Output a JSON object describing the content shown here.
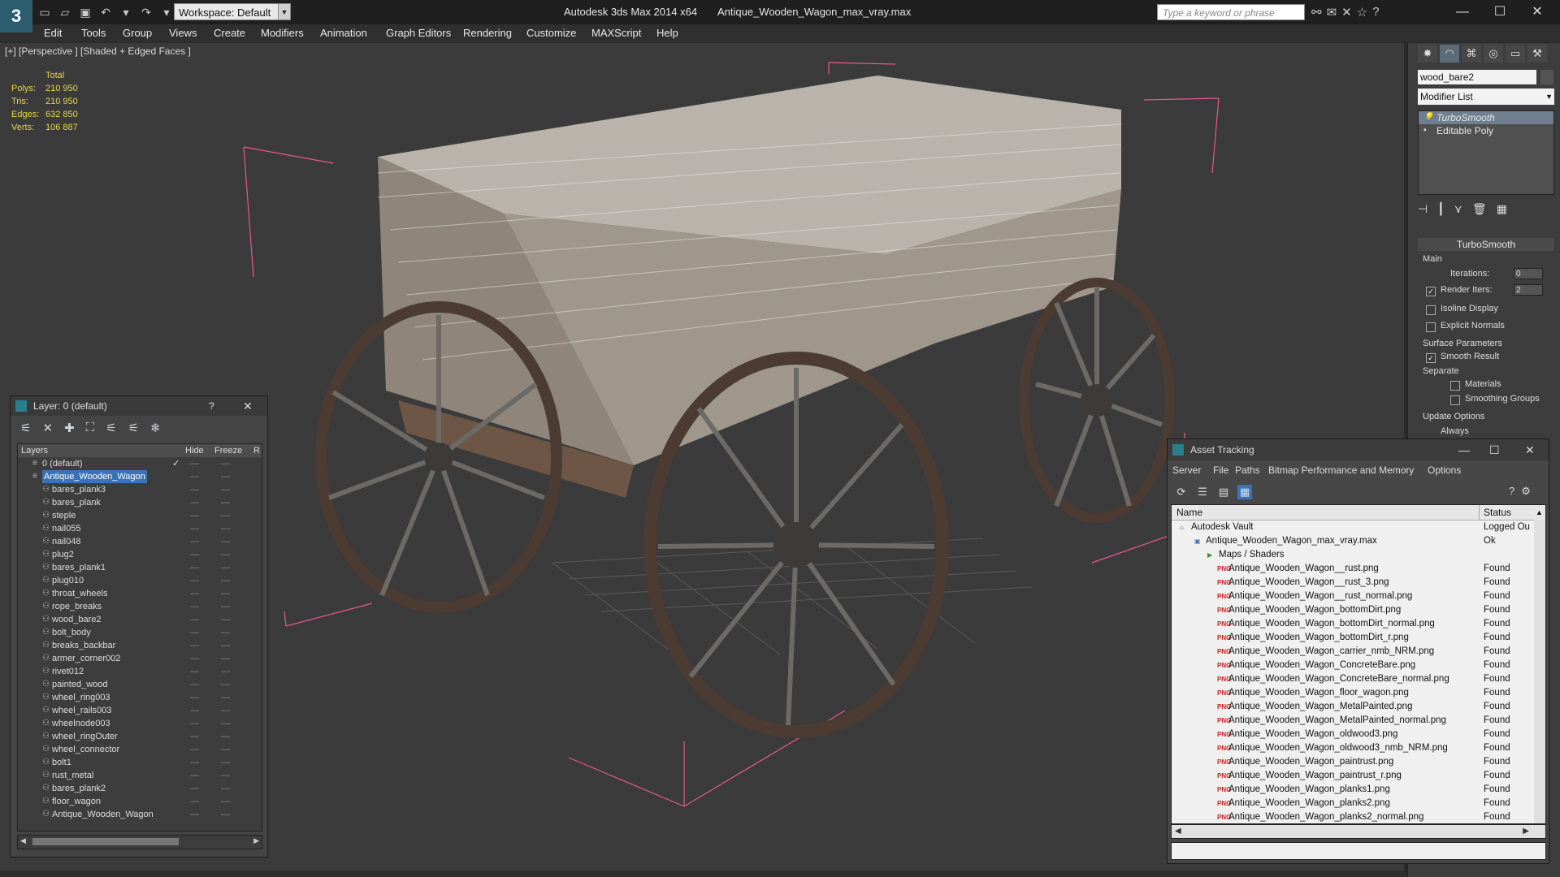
{
  "titlebar": {
    "app_title": "Autodesk 3ds Max  2014 x64",
    "file_title": "Antique_Wooden_Wagon_max_vray.max",
    "workspace": "Workspace: Default",
    "search_placeholder": "Type a keyword or phrase"
  },
  "menu": [
    "Edit",
    "Tools",
    "Group",
    "Views",
    "Create",
    "Modifiers",
    "Animation",
    "Graph Editors",
    "Rendering",
    "Customize",
    "MAXScript",
    "Help"
  ],
  "viewport": {
    "label": "[+] [Perspective ] [Shaded + Edged Faces ]",
    "stats": {
      "header": "Total",
      "rows": [
        {
          "k": "Polys:",
          "v": "210 950"
        },
        {
          "k": "Tris:",
          "v": "210 950"
        },
        {
          "k": "Edges:",
          "v": "632 850"
        },
        {
          "k": "Verts:",
          "v": "106 887"
        }
      ]
    }
  },
  "command_panel": {
    "object_name": "wood_bare2",
    "modifier_list": "Modifier List",
    "stack": [
      "TurboSmooth",
      "Editable Poly"
    ],
    "rollout": "TurboSmooth",
    "main_label": "Main",
    "iterations_label": "Iterations:",
    "iterations_value": "0",
    "render_iters_label": "Render Iters:",
    "render_iters_value": "2",
    "isoline": "Isoline Display",
    "explicit_normals": "Explicit Normals",
    "surface_params": "Surface Parameters",
    "smooth_result": "Smooth Result",
    "separate": "Separate",
    "materials": "Materials",
    "smoothing_groups": "Smoothing Groups",
    "update_options": "Update Options",
    "always": "Always"
  },
  "layer_window": {
    "title": "Layer: 0 (default)",
    "help": "?",
    "columns": {
      "layers": "Layers",
      "hide": "Hide",
      "freeze": "Freeze",
      "r": "R"
    },
    "rows": [
      {
        "name": "0 (default)",
        "level": 0,
        "check": "✓"
      },
      {
        "name": "Antique_Wooden_Wagon",
        "level": 0,
        "selected": true
      },
      {
        "name": "bares_plank3",
        "level": 1
      },
      {
        "name": "bares_plank",
        "level": 1
      },
      {
        "name": "steple",
        "level": 1
      },
      {
        "name": "nail055",
        "level": 1
      },
      {
        "name": "nail048",
        "level": 1
      },
      {
        "name": "plug2",
        "level": 1
      },
      {
        "name": "bares_plank1",
        "level": 1
      },
      {
        "name": "plug010",
        "level": 1
      },
      {
        "name": "throat_wheels",
        "level": 1
      },
      {
        "name": "rope_breaks",
        "level": 1
      },
      {
        "name": "wood_bare2",
        "level": 1
      },
      {
        "name": "bolt_body",
        "level": 1
      },
      {
        "name": "breaks_backbar",
        "level": 1
      },
      {
        "name": "armer_corner002",
        "level": 1
      },
      {
        "name": "rivet012",
        "level": 1
      },
      {
        "name": "painted_wood",
        "level": 1
      },
      {
        "name": "wheel_ring003",
        "level": 1
      },
      {
        "name": "wheel_rails003",
        "level": 1
      },
      {
        "name": "wheelnode003",
        "level": 1
      },
      {
        "name": "wheel_ringOuter",
        "level": 1
      },
      {
        "name": "wheel_connector",
        "level": 1
      },
      {
        "name": "bolt1",
        "level": 1
      },
      {
        "name": "rust_metal",
        "level": 1
      },
      {
        "name": "bares_plank2",
        "level": 1
      },
      {
        "name": "floor_wagon",
        "level": 1
      },
      {
        "name": "Antique_Wooden_Wagon",
        "level": 1
      }
    ]
  },
  "asset_window": {
    "title": "Asset Tracking",
    "menu": [
      "Server",
      "File",
      "Paths",
      "Bitmap Performance and Memory",
      "Options"
    ],
    "columns": {
      "name": "Name",
      "status": "Status"
    },
    "rows": [
      {
        "name": "Autodesk Vault",
        "status": "Logged Ou",
        "level": 0
      },
      {
        "name": "Antique_Wooden_Wagon_max_vray.max",
        "status": "Ok",
        "level": 1
      },
      {
        "name": "Maps / Shaders",
        "status": "",
        "level": 2
      },
      {
        "name": "Antique_Wooden_Wagon__rust.png",
        "status": "Found",
        "level": 3
      },
      {
        "name": "Antique_Wooden_Wagon__rust_3.png",
        "status": "Found",
        "level": 3
      },
      {
        "name": "Antique_Wooden_Wagon__rust_normal.png",
        "status": "Found",
        "level": 3
      },
      {
        "name": "Antique_Wooden_Wagon_bottomDirt.png",
        "status": "Found",
        "level": 3
      },
      {
        "name": "Antique_Wooden_Wagon_bottomDirt_normal.png",
        "status": "Found",
        "level": 3
      },
      {
        "name": "Antique_Wooden_Wagon_bottomDirt_r.png",
        "status": "Found",
        "level": 3
      },
      {
        "name": "Antique_Wooden_Wagon_carrier_nmb_NRM.png",
        "status": "Found",
        "level": 3
      },
      {
        "name": "Antique_Wooden_Wagon_ConcreteBare.png",
        "status": "Found",
        "level": 3
      },
      {
        "name": "Antique_Wooden_Wagon_ConcreteBare_normal.png",
        "status": "Found",
        "level": 3
      },
      {
        "name": "Antique_Wooden_Wagon_floor_wagon.png",
        "status": "Found",
        "level": 3
      },
      {
        "name": "Antique_Wooden_Wagon_MetalPainted.png",
        "status": "Found",
        "level": 3
      },
      {
        "name": "Antique_Wooden_Wagon_MetalPainted_normal.png",
        "status": "Found",
        "level": 3
      },
      {
        "name": "Antique_Wooden_Wagon_oldwood3.png",
        "status": "Found",
        "level": 3
      },
      {
        "name": "Antique_Wooden_Wagon_oldwood3_nmb_NRM.png",
        "status": "Found",
        "level": 3
      },
      {
        "name": "Antique_Wooden_Wagon_paintrust.png",
        "status": "Found",
        "level": 3
      },
      {
        "name": "Antique_Wooden_Wagon_paintrust_r.png",
        "status": "Found",
        "level": 3
      },
      {
        "name": "Antique_Wooden_Wagon_planks1.png",
        "status": "Found",
        "level": 3
      },
      {
        "name": "Antique_Wooden_Wagon_planks2.png",
        "status": "Found",
        "level": 3
      },
      {
        "name": "Antique_Wooden_Wagon_planks2_normal.png",
        "status": "Found",
        "level": 3
      }
    ]
  }
}
